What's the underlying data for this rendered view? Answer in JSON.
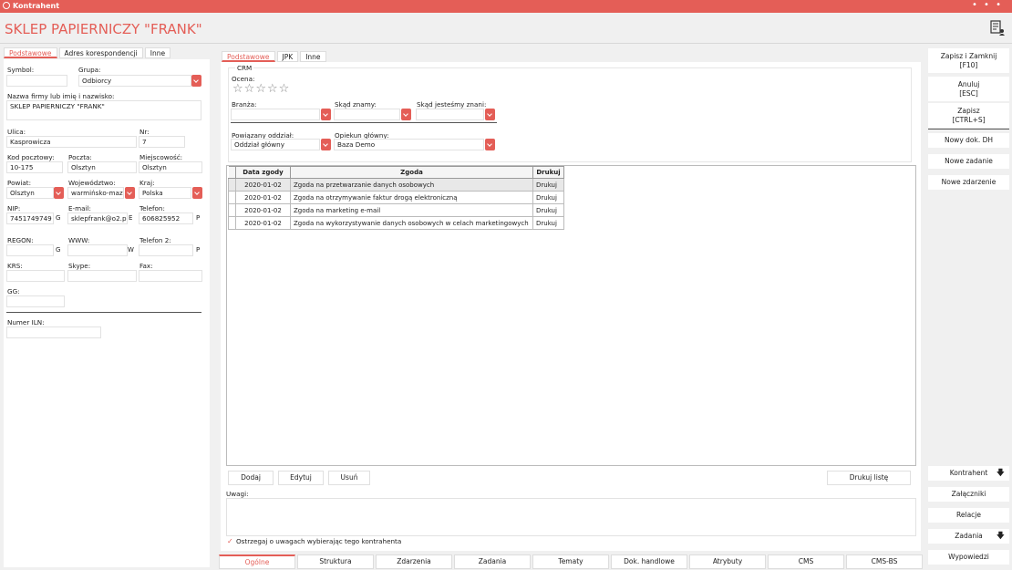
{
  "window": {
    "title": "Kontrahent"
  },
  "header": {
    "title": "SKLEP PAPIERNICZY \"FRANK\""
  },
  "left": {
    "tabs": [
      "Podstawowe",
      "Adres korespondencji",
      "Inne"
    ],
    "symbol_label": "Symbol:",
    "symbol_value": "",
    "grupa_label": "Grupa:",
    "grupa_value": "Odbiorcy",
    "nazwa_label": "Nazwa firmy lub imię i nazwisko:",
    "nazwa_value": "SKLEP PAPIERNICZY \"FRANK\"",
    "ulica_label": "Ulica:",
    "ulica_value": "Kasprowicza",
    "nr_label": "Nr:",
    "nr_value": "7",
    "kod_label": "Kod pocztowy:",
    "kod_value": "10-175",
    "poczta_label": "Poczta:",
    "poczta_value": "Olsztyn",
    "miejsc_label": "Miejscowość:",
    "miejsc_value": "Olsztyn",
    "powiat_label": "Powiat:",
    "powiat_value": "Olsztyn",
    "woj_label": "Województwo:",
    "woj_value": "warmińsko-mazu",
    "kraj_label": "Kraj:",
    "kraj_value": "Polska",
    "nip_label": "NIP:",
    "nip_value": "7451749749",
    "nip_sfx": "G",
    "email_label": "E-mail:",
    "email_value": "sklepfrank@o2.pl",
    "email_sfx": "E",
    "tel_label": "Telefon:",
    "tel_value": "606825952",
    "tel_sfx": "P",
    "regon_label": "REGON:",
    "regon_sfx": "G",
    "www_label": "WWW:",
    "www_sfx": "W",
    "tel2_label": "Telefon 2:",
    "tel2_sfx": "P",
    "krs_label": "KRS:",
    "skype_label": "Skype:",
    "fax_label": "Fax:",
    "gg_label": "GG:",
    "iln_label": "Numer ILN:"
  },
  "middle": {
    "tabs": [
      "Podstawowe",
      "JPK",
      "Inne"
    ],
    "crm_label": "CRM",
    "ocena_label": "Ocena:",
    "branza_label": "Branża:",
    "skad_label": "Skąd znamy:",
    "skad_jestesmy_label": "Skąd jesteśmy znani:",
    "oddzial_label": "Powiązany oddział:",
    "oddzial_value": "Oddział główny",
    "opiekun_label": "Opiekun główny:",
    "opiekun_value": "Baza Demo",
    "table_headers": [
      "Data zgody",
      "Zgoda",
      "Drukuj"
    ],
    "rows": [
      {
        "data": "2020-01-02",
        "zgoda": "Zgoda na przetwarzanie danych osobowych",
        "drukuj": "Drukuj"
      },
      {
        "data": "2020-01-02",
        "zgoda": "Zgoda na otrzymywanie faktur drogą elektroniczną",
        "drukuj": "Drukuj"
      },
      {
        "data": "2020-01-02",
        "zgoda": "Zgoda na marketing e-mail",
        "drukuj": "Drukuj"
      },
      {
        "data": "2020-01-02",
        "zgoda": "Zgoda na wykorzystywanie danych osobowych w celach marketingowych",
        "drukuj": "Drukuj"
      }
    ],
    "dodaj": "Dodaj",
    "edytuj": "Edytuj",
    "usun": "Usuń",
    "drukuj_liste": "Drukuj listę",
    "uwagi_label": "Uwagi:",
    "ostrzegaj_label": "Ostrzegaj o uwagach wybierając tego kontrahenta"
  },
  "bottom_tabs": [
    "Ogólne",
    "Struktura",
    "Zdarzenia",
    "Zadania",
    "Tematy",
    "Dok. handlowe",
    "Atrybuty",
    "CMS",
    "CMS-BS"
  ],
  "right": {
    "zapisz_zamknij": "Zapisz i Zamknij",
    "zapisz_zamknij_key": "[F10]",
    "anuluj": "Anuluj",
    "anuluj_key": "[ESC]",
    "zapisz": "Zapisz",
    "zapisz_key": "[CTRL+S]",
    "nowy_dok": "Nowy dok. DH",
    "nowe_zadanie": "Nowe zadanie",
    "nowe_zdarzenie": "Nowe zdarzenie",
    "kontrahent": "Kontrahent",
    "zalaczniki": "Załączniki",
    "relacje": "Relacje",
    "zadania": "Zadania",
    "wypowiedzi": "Wypowiedzi"
  },
  "colors": {
    "accent": "#e45e57"
  }
}
